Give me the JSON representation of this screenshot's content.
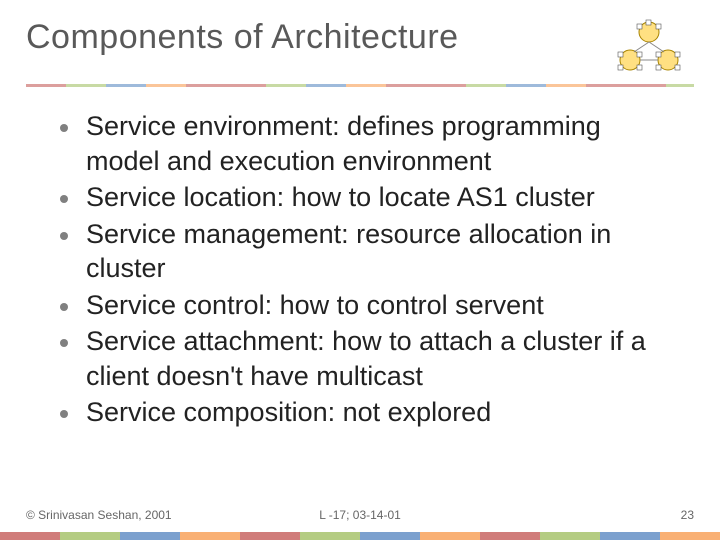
{
  "title": "Components of Architecture",
  "bullets": [
    "Service environment: defines programming model and execution environment",
    "Service location: how to locate AS1 cluster",
    "Service management: resource allocation in cluster",
    "Service control: how to control servent",
    "Service attachment: how to attach a cluster if a client doesn't have multicast",
    "Service composition: not explored"
  ],
  "footer": {
    "left": "© Srinivasan Seshan, 2001",
    "center": "L -17; 03-14-01",
    "right": "23"
  }
}
